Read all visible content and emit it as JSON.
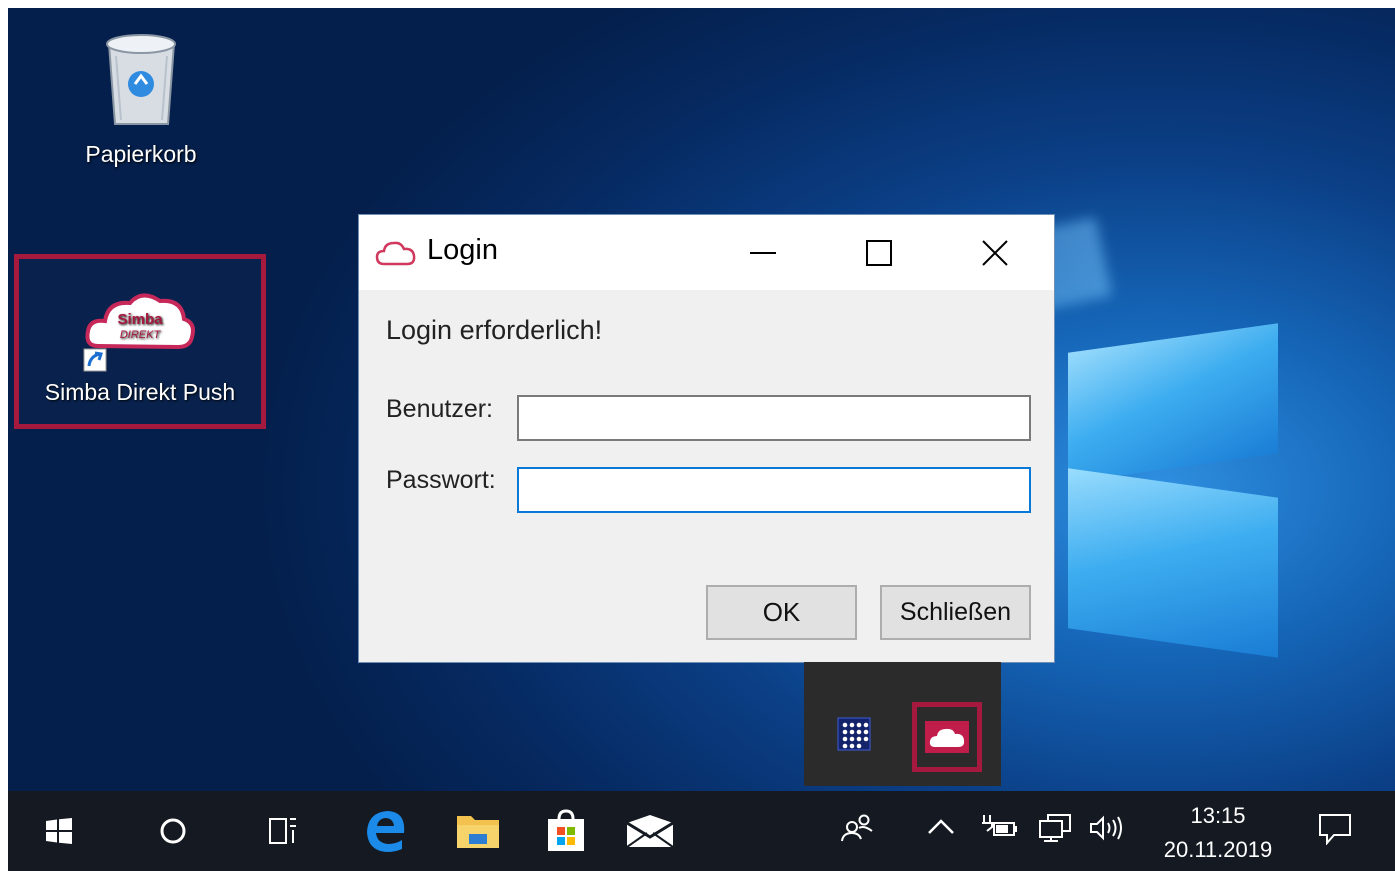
{
  "desktop": {
    "icons": [
      {
        "label": "Papierkorb"
      },
      {
        "label": "Simba Direkt Push",
        "logo_text_top": "Simba",
        "logo_text_bottom": "DIREKT"
      }
    ]
  },
  "dialog": {
    "title": "Login",
    "message": "Login erforderlich!",
    "user_label": "Benutzer:",
    "user_value": "",
    "password_label": "Passwort:",
    "password_value": "",
    "ok_label": "OK",
    "close_label": "Schließen"
  },
  "tray_popup": {
    "items": [
      {
        "icon": "grid-app-icon"
      },
      {
        "icon": "simba-cloud-icon"
      }
    ]
  },
  "taskbar": {
    "items": [
      {
        "icon": "windows-start-icon"
      },
      {
        "icon": "cortana-search-icon"
      },
      {
        "icon": "task-view-icon"
      },
      {
        "icon": "edge-browser-icon"
      },
      {
        "icon": "file-explorer-icon"
      },
      {
        "icon": "store-icon"
      },
      {
        "icon": "mail-icon"
      }
    ],
    "tray": {
      "time": "13:15",
      "date": "20.11.2019"
    }
  },
  "colors": {
    "highlight": "#a6193f",
    "taskbar": "#151a22",
    "focus_border": "#0a78d7"
  }
}
